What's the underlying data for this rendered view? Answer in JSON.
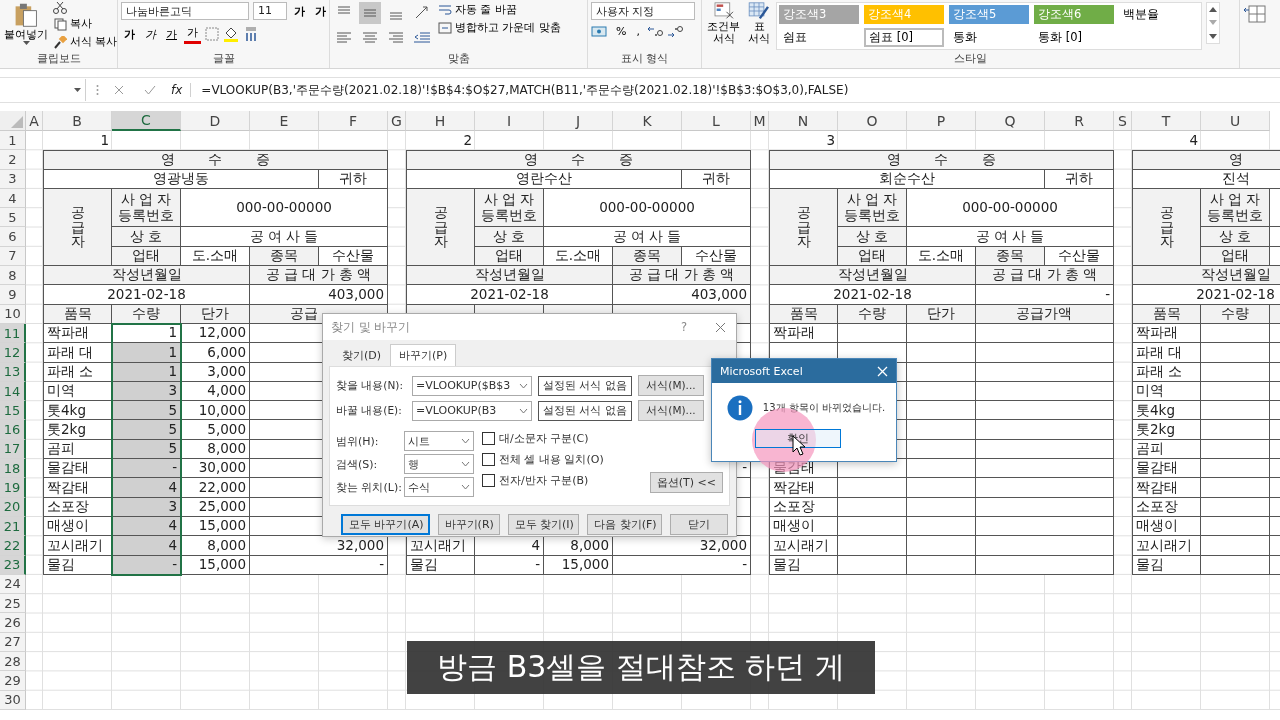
{
  "ribbon": {
    "clipboard": {
      "label": "클립보드",
      "paste": "붙여넣기",
      "copy": "복사",
      "format_painter": "서식 복사"
    },
    "font": {
      "label": "글꼴",
      "font_name": "나눔바른고딕",
      "font_size": "11",
      "buttons": [
        {
          "kind": "grow",
          "text": "가"
        },
        {
          "kind": "shrink",
          "text": "가"
        },
        {
          "kind": "bold",
          "text": "가"
        },
        {
          "kind": "italic",
          "text": "가"
        },
        {
          "kind": "underline",
          "text": "가"
        },
        {
          "kind": "color",
          "text": "가"
        }
      ]
    },
    "alignment": {
      "label": "맞춤",
      "vertical": [
        {
          "kind": "top",
          "selected": false
        },
        {
          "kind": "middle",
          "selected": true
        },
        {
          "kind": "bottom",
          "selected": false
        }
      ],
      "wrap": "자동 줄 바꿈",
      "merge": "병합하고 가운데 맞춤"
    },
    "number": {
      "label": "표시 형식",
      "format": "사용자 지정",
      "percent": "%",
      "comma": ","
    },
    "styles": {
      "label": "스타일",
      "conditional": [
        "조건부",
        "서식"
      ],
      "table": [
        "표",
        "서식"
      ],
      "cells": [
        {
          "text": "강조색3",
          "color": "#a5a5a5",
          "selected": false
        },
        {
          "text": "강조색4",
          "color": "#ffc000",
          "selected": false
        },
        {
          "text": "강조색5",
          "color": "#5b9bd5",
          "selected": false
        },
        {
          "text": "강조색6",
          "color": "#70ad47",
          "selected": false
        },
        {
          "text": "백분율",
          "selected": false
        },
        {
          "text": "쉼표",
          "selected": false
        },
        {
          "text": "쉼표 [0]",
          "selected": true
        },
        {
          "text": "통화",
          "selected": false
        },
        {
          "text": "통화 [0]",
          "selected": false
        }
      ]
    }
  },
  "formula_bar": {
    "fx": "fx",
    "formula": "=VLOOKUP(B3,'주문수량(2021.02.18)'!$B$4:$O$27,MATCH(B11,'주문수량(2021.02.18)'!$B$3:$O$3,0),FALSE)"
  },
  "sheet": {
    "columns": [
      {
        "label": "A",
        "selected": false
      },
      {
        "label": "B",
        "selected": false
      },
      {
        "label": "C",
        "selected": true
      },
      {
        "label": "D",
        "selected": false
      },
      {
        "label": "E",
        "selected": false
      },
      {
        "label": "F",
        "selected": false
      },
      {
        "label": "G",
        "selected": false
      },
      {
        "label": "H",
        "selected": false
      },
      {
        "label": "I",
        "selected": false
      },
      {
        "label": "J",
        "selected": false
      },
      {
        "label": "K",
        "selected": false
      },
      {
        "label": "L",
        "selected": false
      },
      {
        "label": "M",
        "selected": false
      },
      {
        "label": "N",
        "selected": false
      },
      {
        "label": "O",
        "selected": false
      },
      {
        "label": "P",
        "selected": false
      },
      {
        "label": "Q",
        "selected": false
      },
      {
        "label": "R",
        "selected": false
      },
      {
        "label": "S",
        "selected": false
      },
      {
        "label": "T",
        "selected": false
      },
      {
        "label": "U",
        "selected": false
      }
    ],
    "rows": [
      {
        "label": "1",
        "selected": false
      },
      {
        "label": "2",
        "selected": false
      },
      {
        "label": "3",
        "selected": false
      },
      {
        "label": "4",
        "selected": false
      },
      {
        "label": "5",
        "selected": false
      },
      {
        "label": "6",
        "selected": false
      },
      {
        "label": "7",
        "selected": false
      },
      {
        "label": "8",
        "selected": false
      },
      {
        "label": "9",
        "selected": false
      },
      {
        "label": "10",
        "selected": false
      },
      {
        "label": "11",
        "selected": true
      },
      {
        "label": "12",
        "selected": true
      },
      {
        "label": "13",
        "selected": true
      },
      {
        "label": "14",
        "selected": true
      },
      {
        "label": "15",
        "selected": true
      },
      {
        "label": "16",
        "selected": true
      },
      {
        "label": "17",
        "selected": true
      },
      {
        "label": "18",
        "selected": true
      },
      {
        "label": "19",
        "selected": true
      },
      {
        "label": "20",
        "selected": true
      },
      {
        "label": "21",
        "selected": true
      },
      {
        "label": "22",
        "selected": true
      },
      {
        "label": "23",
        "selected": true
      },
      {
        "label": "24",
        "selected": false
      },
      {
        "label": "25",
        "selected": false
      },
      {
        "label": "26",
        "selected": false
      },
      {
        "label": "27",
        "selected": false
      },
      {
        "label": "28",
        "selected": false
      },
      {
        "label": "29",
        "selected": false
      },
      {
        "label": "30",
        "selected": false
      }
    ],
    "receipts": [
      {
        "number": "1",
        "title": "영 수 증",
        "company": "영광냉동",
        "honorific": "귀하",
        "supplier_label": "공급자",
        "reg_label": [
          "사 업 자",
          "등록번호"
        ],
        "reg_no": "000-00-00000",
        "name_label": "상 호",
        "name": "공 여 사 들",
        "biz_label": "업태",
        "biz_type": "도.소매",
        "item_label": "종목",
        "item_type": "수산물",
        "date_label": "작성년월일",
        "total_label": "공 급 대 가 총 액",
        "date": "2021-02-18",
        "total": "403,000",
        "headers": [
          "품목",
          "수량",
          "단가",
          "공급"
        ],
        "rows": [
          {
            "item": "짝파래",
            "qty": "1",
            "price": "12,000",
            "selected": true
          },
          {
            "item": "파래 대",
            "qty": "1",
            "price": "6,000",
            "selected": true
          },
          {
            "item": "파래 소",
            "qty": "1",
            "price": "3,000",
            "selected": true
          },
          {
            "item": "미역",
            "qty": "3",
            "price": "4,000",
            "selected": true
          },
          {
            "item": "톳4kg",
            "qty": "5",
            "price": "10,000",
            "selected": true
          },
          {
            "item": "톳2kg",
            "qty": "5",
            "price": "5,000",
            "selected": true
          },
          {
            "item": "곰피",
            "qty": "5",
            "price": "8,000",
            "selected": true
          },
          {
            "item": "물감태",
            "qty": "-",
            "price": "30,000",
            "selected": true
          },
          {
            "item": "짝감태",
            "qty": "4",
            "price": "22,000",
            "selected": true
          },
          {
            "item": "소포장",
            "qty": "3",
            "price": "25,000",
            "selected": true
          },
          {
            "item": "매생이",
            "qty": "4",
            "price": "15,000",
            "selected": true
          },
          {
            "item": "꼬시래기",
            "qty": "4",
            "price": "8,000",
            "amount": "32,000",
            "selected": true
          },
          {
            "item": "물김",
            "qty": "-",
            "price": "15,000",
            "amount": "-",
            "selected": true
          }
        ]
      },
      {
        "number": "2",
        "title": "영 수 증",
        "company": "영란수산",
        "honorific": "귀하",
        "supplier_label": "공급자",
        "reg_label": [
          "사 업 자",
          "등록번호"
        ],
        "reg_no": "000-00-00000",
        "name_label": "상 호",
        "name": "공 여 사 들",
        "biz_label": "업태",
        "biz_type": "도.소매",
        "item_label": "종목",
        "item_type": "수산물",
        "date_label": "작성년월일",
        "total_label": "공 급 대 가 총 액",
        "date": "2021-02-18",
        "total": "403,000",
        "rows": [
          {},
          {},
          {},
          {},
          {},
          {},
          {},
          {
            "amount": "-"
          },
          {},
          {},
          {},
          {
            "item": "꼬시래기",
            "qty": "4",
            "price": "8,000",
            "amount": "32,000"
          },
          {
            "item": "물김",
            "qty": "-",
            "price": "15,000",
            "amount": "-"
          }
        ]
      },
      {
        "number": "3",
        "title": "영 수 증",
        "company": "회순수산",
        "honorific": "귀하",
        "supplier_label": "공급자",
        "reg_label": [
          "사 업 자",
          "등록번호"
        ],
        "reg_no": "000-00-00000",
        "name_label": "상 호",
        "name": "공 여 사 들",
        "biz_label": "업태",
        "biz_type": "도.소매",
        "item_label": "종목",
        "item_type": "수산물",
        "date_label": "작성년월일",
        "total_label": "공 급 대 가 총 액",
        "date": "2021-02-18",
        "total": "-",
        "headers": [
          "품목",
          "수량",
          "단가",
          "공급가액"
        ],
        "rows": [
          {
            "item": "짝파래",
            "selected": false
          },
          {
            "selected": false
          },
          {
            "selected": false
          },
          {
            "selected": false
          },
          {
            "selected": false
          },
          {
            "selected": false
          },
          {
            "selected": false
          },
          {
            "item": "물감태",
            "selected": false
          },
          {
            "item": "짝감태",
            "selected": false
          },
          {
            "item": "소포장",
            "selected": false
          },
          {
            "item": "매생이",
            "selected": false
          },
          {
            "item": "꼬시래기",
            "selected": false
          },
          {
            "item": "물김",
            "selected": false
          }
        ]
      },
      {
        "number": "4",
        "title": "영",
        "company": "진석",
        "supplier_label": "공급자",
        "reg_label": [
          "사 업 자",
          "등록번호"
        ],
        "name_label": "상 호",
        "biz_label": "업태",
        "date_label": "작성년월일",
        "date": "2021-02-18",
        "headers": [
          "품목",
          "수량"
        ],
        "rows": [
          {
            "item": "짝파래",
            "selected": false
          },
          {
            "item": "파래 대",
            "selected": false
          },
          {
            "item": "파래 소",
            "selected": false
          },
          {
            "item": "미역",
            "selected": false
          },
          {
            "item": "톳4kg",
            "selected": false
          },
          {
            "item": "톳2kg",
            "selected": false
          },
          {
            "item": "곰피",
            "selected": false
          },
          {
            "item": "물감태",
            "selected": false
          },
          {
            "item": "짝감태",
            "selected": false
          },
          {
            "item": "소포장",
            "selected": false
          },
          {
            "item": "매생이",
            "selected": false
          },
          {
            "item": "꼬시래기",
            "selected": false
          },
          {
            "item": "물김",
            "selected": false
          }
        ]
      }
    ]
  },
  "find_dialog": {
    "title": "찾기 및 바꾸기",
    "help": "?",
    "tabs": [
      {
        "label": "찾기(D)",
        "selected": false
      },
      {
        "label": "바꾸기(P)",
        "selected": true
      }
    ],
    "fields": [
      {
        "label": "찾을 내용(N):",
        "value": "=VLOOKUP($B$3",
        "format": "설정된 서식 없음",
        "format_button": "서식(M)..."
      },
      {
        "label": "바꿀 내용(E):",
        "value": "=VLOOKUP(B3",
        "format": "설정된 서식 없음",
        "format_button": "서식(M)..."
      }
    ],
    "options": [
      {
        "label": "범위(H):",
        "value": "시트"
      },
      {
        "label": "검색(S):",
        "value": "행"
      },
      {
        "label": "찾는 위치(L):",
        "value": "수식"
      }
    ],
    "checkboxes": [
      {
        "label": "대/소문자 구분(C)",
        "checked": false
      },
      {
        "label": "전체 셀 내용 일치(O)",
        "checked": false
      },
      {
        "label": "전자/반자 구분(B)",
        "checked": false
      }
    ],
    "options_button": "옵션(T) <<",
    "buttons": [
      {
        "label": "모두 바꾸기(A)",
        "default": true
      },
      {
        "label": "바꾸기(R)",
        "default": false
      },
      {
        "label": "모두 찾기(I)",
        "default": false
      },
      {
        "label": "다음 찾기(F)",
        "default": false
      },
      {
        "label": "닫기",
        "default": false
      }
    ]
  },
  "message_box": {
    "title": "Microsoft Excel",
    "message": "13개 항목이 바뀌었습니다.",
    "button": "확인"
  },
  "subtitle": {
    "text": "방금 B3셀을 절대참조 하던 게"
  }
}
